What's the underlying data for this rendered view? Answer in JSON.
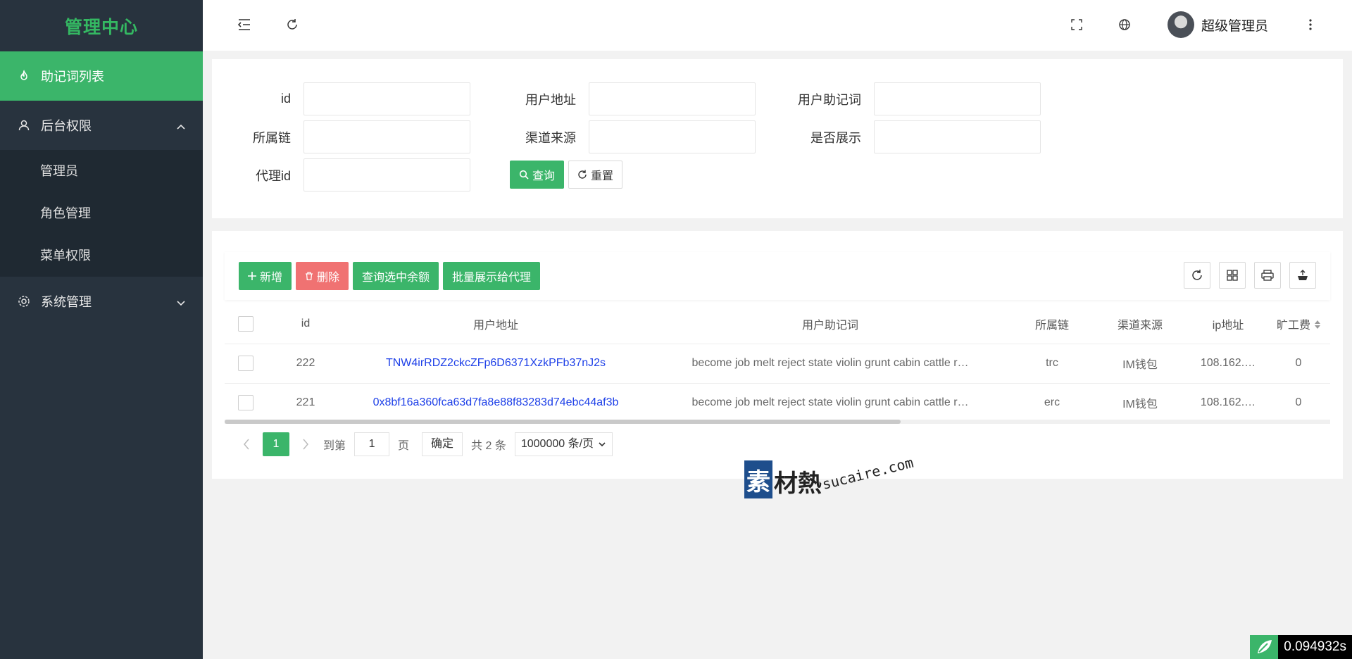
{
  "sidebar": {
    "title": "管理中心",
    "items": [
      {
        "label": "助记词列表"
      },
      {
        "label": "后台权限",
        "children": [
          {
            "label": "管理员"
          },
          {
            "label": "角色管理"
          },
          {
            "label": "菜单权限"
          }
        ]
      },
      {
        "label": "系统管理"
      }
    ]
  },
  "header": {
    "user_name": "超级管理员",
    "icons": [
      "menu-fold-icon",
      "refresh-icon",
      "fullscreen-icon",
      "globe-icon",
      "more-vertical-icon"
    ]
  },
  "search": {
    "fields": {
      "id": {
        "label": "id",
        "value": ""
      },
      "address": {
        "label": "用户地址",
        "value": ""
      },
      "mnemonic": {
        "label": "用户助记词",
        "value": ""
      },
      "chain": {
        "label": "所属链",
        "value": ""
      },
      "channel": {
        "label": "渠道来源",
        "value": ""
      },
      "display": {
        "label": "是否展示",
        "value": ""
      },
      "agent_id": {
        "label": "代理id",
        "value": ""
      }
    },
    "query_label": "查询",
    "reset_label": "重置"
  },
  "toolbar": {
    "add_label": "新增",
    "delete_label": "删除",
    "query_balance_label": "查询选中余额",
    "batch_show_label": "批量展示给代理"
  },
  "table": {
    "columns": [
      "id",
      "用户地址",
      "用户助记词",
      "所属链",
      "渠道来源",
      "ip地址",
      "旷工费"
    ],
    "rows": [
      {
        "id": "222",
        "address": "TNW4irRDZ2ckcZFp6D6371XzkPFb37nJ2s",
        "mnemonic": "become job melt reject state violin grunt cabin cattle r…",
        "chain": "trc",
        "channel": "IM钱包",
        "ip": "108.162.…",
        "fee": "0"
      },
      {
        "id": "221",
        "address": "0x8bf16a360fca63d7fa8e88f83283d74ebc44af3b",
        "mnemonic": "become job melt reject state violin grunt cabin cattle r…",
        "chain": "erc",
        "channel": "IM钱包",
        "ip": "108.162.…",
        "fee": "0"
      }
    ]
  },
  "pager": {
    "current": "1",
    "goto_label": "到第",
    "goto_value": "1",
    "page_unit": "页",
    "ok_label": "确定",
    "total_label": "共 2 条",
    "page_size": "1000000 条/页"
  },
  "watermark": {
    "box": "素",
    "text": "材熱",
    "url": "sucaire.com"
  },
  "timer": {
    "value": "0.094932s"
  },
  "colors": {
    "accent": "#3bb56a",
    "sidebar_bg": "#28333e",
    "danger": "#f07272",
    "link": "#1e40e8"
  }
}
